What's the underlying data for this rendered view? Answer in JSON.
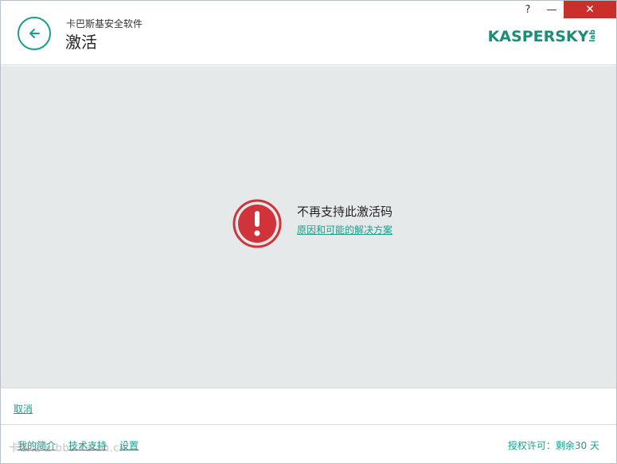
{
  "header": {
    "app_name": "卡巴斯基安全软件",
    "title": "激活",
    "logo_text": "KASPERSKY",
    "logo_sub": "lab"
  },
  "window_controls": {
    "help": "?",
    "minimize": "—",
    "close": "✕"
  },
  "alert": {
    "icon": "exclamation-circle-icon",
    "message": "不再支持此激活码",
    "link": "原因和可能的解决方案"
  },
  "cancel_bar": {
    "cancel": "取消"
  },
  "footer": {
    "links": [
      "我的简介",
      "技术支持",
      "设置"
    ],
    "license": "授权许可：剩余30 天",
    "watermark": "卡饭论坛 bbs.kafan.cn"
  },
  "colors": {
    "accent": "#1b9e8b",
    "alert_red": "#d0343a",
    "background": "#e6e9ea",
    "close_button": "#c9302c"
  }
}
